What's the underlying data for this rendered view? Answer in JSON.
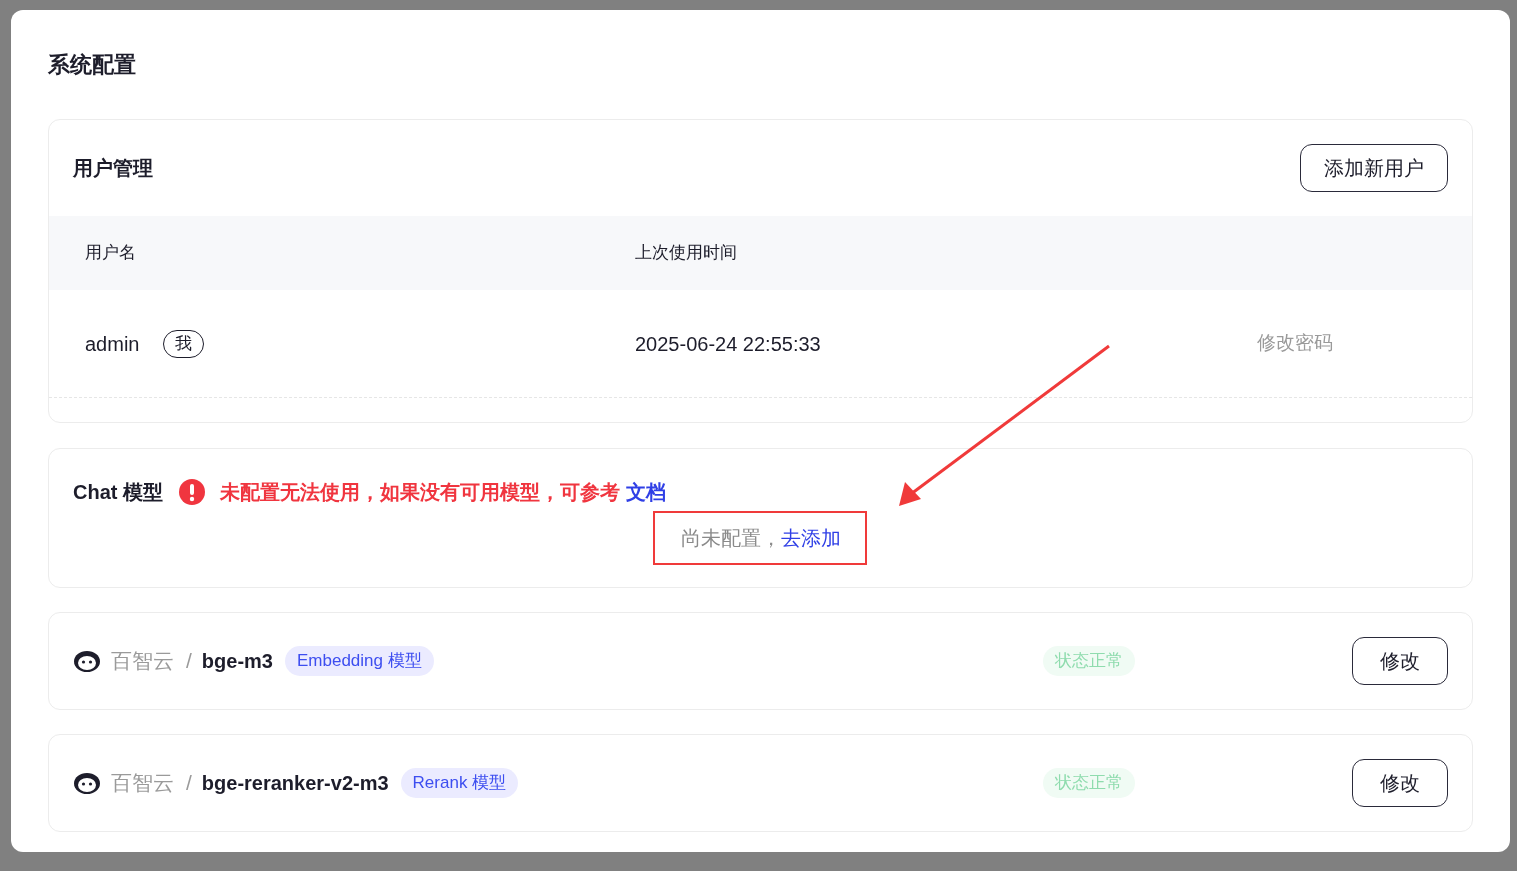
{
  "window": {
    "title": "系统配置"
  },
  "user_management": {
    "title": "用户管理",
    "add_button": "添加新用户",
    "columns": [
      "用户名",
      "上次使用时间"
    ],
    "rows": [
      {
        "username": "admin",
        "self_badge": "我",
        "last_used": "2025-06-24 22:55:33",
        "action": "修改密码"
      }
    ]
  },
  "chat_model": {
    "title": "Chat 模型",
    "warning": "未配置无法使用，如果没有可用模型，可参考",
    "doc_link": "文档",
    "empty_text": "尚未配置，",
    "add_link": "去添加"
  },
  "models": [
    {
      "provider": "百智云",
      "separator": "/",
      "name": "bge-m3",
      "tag": "Embedding 模型",
      "status": "状态正常",
      "button": "修改"
    },
    {
      "provider": "百智云",
      "separator": "/",
      "name": "bge-reranker-v2-m3",
      "tag": "Rerank 模型",
      "status": "状态正常",
      "button": "修改"
    }
  ]
}
